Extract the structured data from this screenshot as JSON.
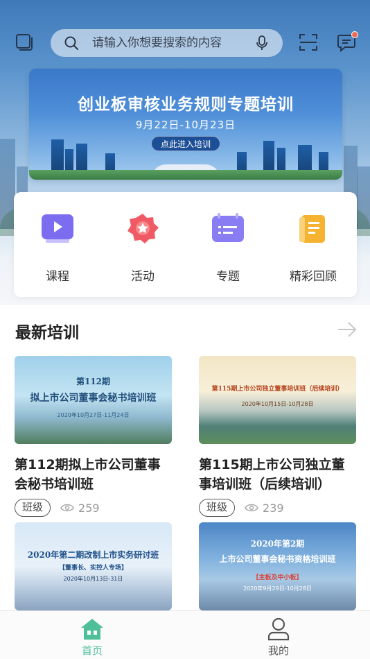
{
  "search": {
    "placeholder": "请输入你想要搜索的内容"
  },
  "topbar": {
    "left_icon": "layers-icon",
    "scan_icon": "scan-icon",
    "message_icon": "message-icon",
    "mic_icon": "mic-icon",
    "colors": {
      "badge": "#f06a55"
    }
  },
  "banner": {
    "title": "创业板审核业务规则专题培训",
    "date": "9月22日-10月23日",
    "button_label": "点此进入培训"
  },
  "categories": [
    {
      "label": "课程",
      "icon": "video-icon",
      "color": "#7b6cf0"
    },
    {
      "label": "活动",
      "icon": "star-badge-icon",
      "color": "#ef5a64"
    },
    {
      "label": "专题",
      "icon": "list-card-icon",
      "color": "#8a7cf3"
    },
    {
      "label": "精彩回顾",
      "icon": "document-icon",
      "color": "#f5b331"
    }
  ],
  "section": {
    "title": "最新培训"
  },
  "courses": [
    {
      "thumb_title_1": "第112期",
      "thumb_title_2": "拟上市公司董事会秘书培训班",
      "thumb_date": "2020年10月27日-11月24日",
      "title": "第112期拟上市公司董事会秘书培训班",
      "tag": "班级",
      "views": "259"
    },
    {
      "thumb_title_1": "第115期上市公司独立董事培训班（后续培训）",
      "thumb_date": "2020年10月15日-10月28日",
      "title": "第115期上市公司独立董事培训班（后续培训）",
      "tag": "班级",
      "views": "239"
    },
    {
      "thumb_title_1": "2020年第二期改制上市实务研讨班",
      "thumb_title_2": "【董事长、实控人专场】",
      "thumb_date": "2020年10月13日-31日"
    },
    {
      "thumb_title_1": "2020年第2期",
      "thumb_title_2": "上市公司董事会秘书资格培训班",
      "thumb_sub": "【主板及中小板】",
      "thumb_date": "2020年9月29日-10月28日"
    }
  ],
  "bottom_nav": [
    {
      "label": "首页",
      "icon": "home-icon",
      "active": true
    },
    {
      "label": "我的",
      "icon": "user-icon",
      "active": false
    }
  ],
  "colors": {
    "accent": "#4fbf9a",
    "nav_inactive": "#555555"
  }
}
